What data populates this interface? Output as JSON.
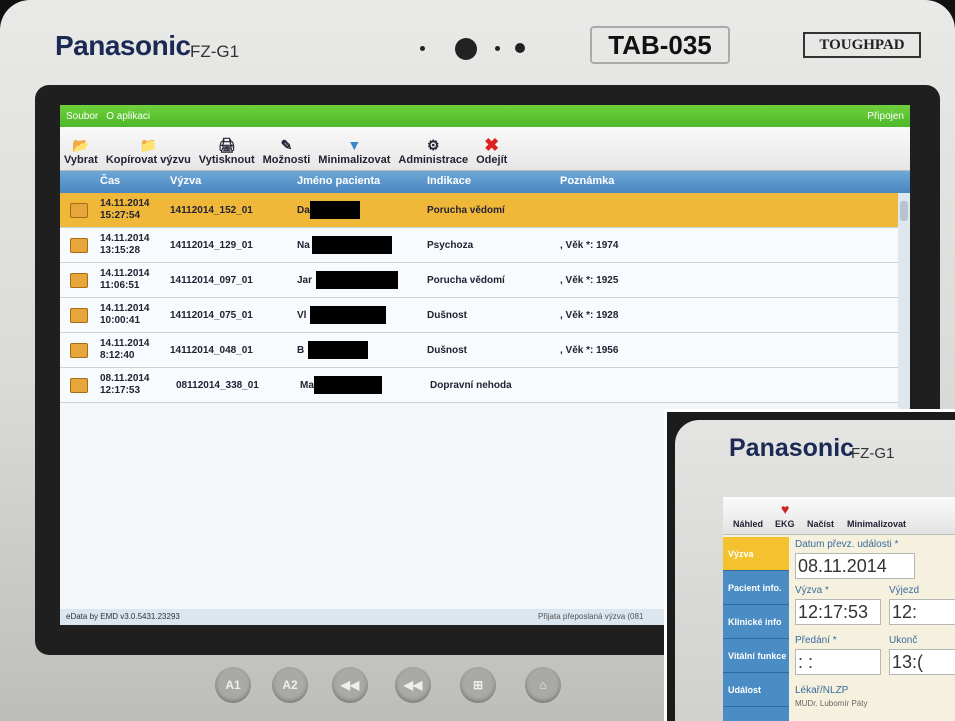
{
  "device": {
    "brand": "Panasonic",
    "model": "FZ-G1",
    "asset_tag": "TAB-035",
    "series": "TOUGHPAD",
    "buttons": [
      "A1",
      "A2",
      "◀◀",
      "◀◀",
      "⊞",
      "⌂"
    ]
  },
  "app": {
    "menu": [
      "Soubor",
      "O aplikaci"
    ],
    "connection_status": "Připojen",
    "toolbar": [
      {
        "label": "Vybrat",
        "icon": "folder-icon"
      },
      {
        "label": "Kopírovat výzvu",
        "icon": "copy-icon"
      },
      {
        "label": "Vytisknout",
        "icon": "printer-icon"
      },
      {
        "label": "Možnosti",
        "icon": "options-icon"
      },
      {
        "label": "Minimalizovat",
        "icon": "minimize-icon"
      },
      {
        "label": "Administrace",
        "icon": "admin-icon"
      },
      {
        "label": "Odejít",
        "icon": "exit-icon"
      }
    ],
    "columns": [
      "Čas",
      "Výzva",
      "Jméno pacienta",
      "Indikace",
      "Poznámka"
    ],
    "rows": [
      {
        "date": "14.11.2014",
        "time": "15:27:54",
        "call": "14112014_152_01",
        "name": "Da",
        "indication": "Porucha vědomí",
        "note": "",
        "selected": true
      },
      {
        "date": "14.11.2014",
        "time": "13:15:28",
        "call": "14112014_129_01",
        "name": "Na",
        "indication": "Psychoza",
        "note": ", Věk *: 1974",
        "selected": false
      },
      {
        "date": "14.11.2014",
        "time": "11:06:51",
        "call": "14112014_097_01",
        "name": "Jar",
        "indication": "Porucha vědomí",
        "note": ", Věk *: 1925",
        "selected": false
      },
      {
        "date": "14.11.2014",
        "time": "10:00:41",
        "call": "14112014_075_01",
        "name": "Vl",
        "indication": "Dušnost",
        "note": ", Věk *: 1928",
        "selected": false
      },
      {
        "date": "14.11.2014",
        "time": "8:12:40",
        "call": "14112014_048_01",
        "name": "B",
        "indication": "Dušnost",
        "note": ", Věk *: 1956",
        "selected": false
      },
      {
        "date": "08.11.2014",
        "time": "12:17:53",
        "call": "08112014_338_01",
        "name": "Ma",
        "indication": "Dopravní nehoda",
        "note": "",
        "selected": false
      }
    ],
    "footer_version": "eData by EMD v3.0.5431.23293",
    "footer_message": "Přijata přeposlaná výzva (081"
  },
  "inset": {
    "toolbar": [
      "Náhled",
      "EKG",
      "Načíst",
      "Minimalizovat"
    ],
    "sidebar": [
      "Výzva",
      "Pacient info.",
      "Klinické info",
      "Vitální funkce",
      "Událost"
    ],
    "fields": {
      "date_label": "Datum převz. události *",
      "date_value": "08.11.2014",
      "call_label": "Výzva *",
      "call_value": "12:17:53",
      "departure_label": "Výjezd",
      "departure_value": "12:",
      "handover_label": "Předání *",
      "handover_value": ":  :",
      "end_label": "Ukonč",
      "end_value": "13:(",
      "doctor_label": "Lékař/NLZP",
      "doctor_value": "MUDr. Lubomír Páty"
    }
  }
}
